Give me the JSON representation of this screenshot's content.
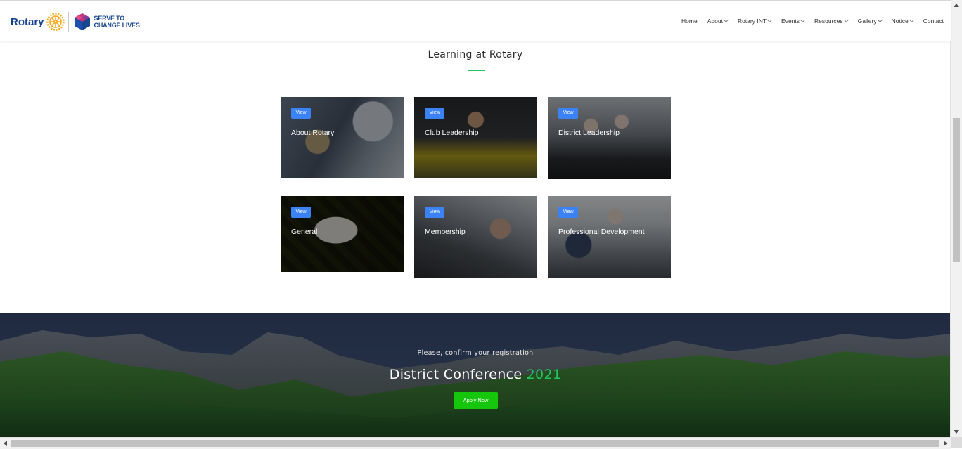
{
  "header": {
    "logo_text": "Rotary",
    "tagline_line1": "SERVE TO",
    "tagline_line2": "CHANGE LIVES",
    "nav": [
      {
        "label": "Home",
        "dropdown": false
      },
      {
        "label": "About",
        "dropdown": true
      },
      {
        "label": "Rotary INT",
        "dropdown": true
      },
      {
        "label": "Events",
        "dropdown": true
      },
      {
        "label": "Resources",
        "dropdown": true
      },
      {
        "label": "Gallery",
        "dropdown": true
      },
      {
        "label": "Notice",
        "dropdown": true
      },
      {
        "label": "Contact",
        "dropdown": false
      }
    ]
  },
  "section": {
    "title": "Learning at Rotary",
    "accent_color": "#22c55e"
  },
  "cards": [
    {
      "badge": "View",
      "title": "About Rotary"
    },
    {
      "badge": "View",
      "title": "Club Leadership"
    },
    {
      "badge": "View",
      "title": "District Leadership"
    },
    {
      "badge": "View",
      "title": "General"
    },
    {
      "badge": "View",
      "title": "Membership"
    },
    {
      "badge": "View",
      "title": "Professional Development"
    }
  ],
  "banner": {
    "subtitle": "Please, confirm your registration",
    "title": "District Conference",
    "year": "2021",
    "button_label": "Apply Now",
    "button_color": "#16c60c"
  },
  "colors": {
    "brand_blue": "#17458f",
    "rotary_gold": "#f7a81b",
    "badge_blue": "#3b82f6"
  }
}
